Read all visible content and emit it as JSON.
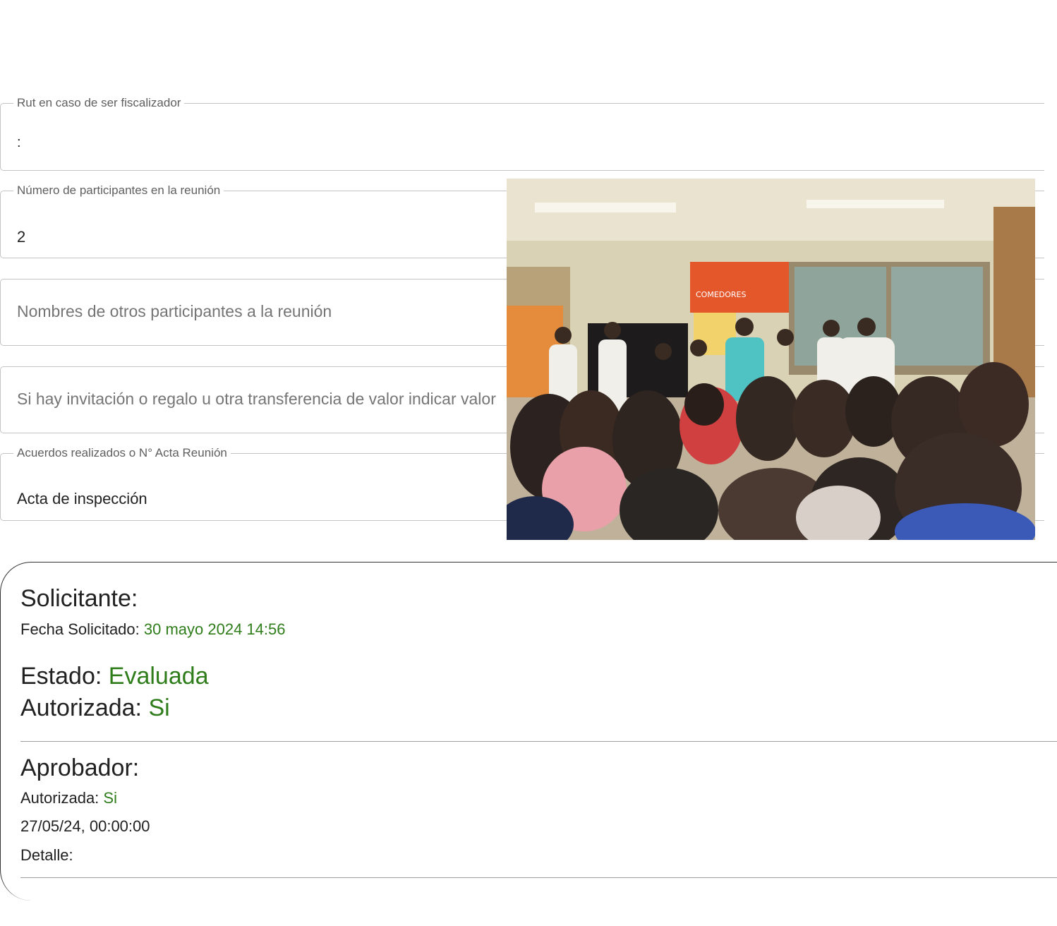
{
  "form": {
    "rut": {
      "label": "Rut en caso de ser fiscalizador",
      "value": ":"
    },
    "participantes": {
      "label": "Número de participantes en la reunión",
      "value": "2"
    },
    "nombres": {
      "placeholder": "Nombres de otros participantes a la reunión"
    },
    "invitacion": {
      "placeholder": "Si hay invitación o regalo u otra transferencia de valor indicar valor"
    },
    "acuerdos": {
      "label": "Acuerdos realizados o N° Acta Reunión",
      "value": "Acta de inspección"
    }
  },
  "photo": {
    "sign_text": "COMEDORES"
  },
  "solicitante": {
    "title": "Solicitante:",
    "fecha_label": "Fecha Solicitado:",
    "fecha_value": "30 mayo 2024 14:56",
    "estado_label": "Estado:",
    "estado_value": "Evaluada",
    "autorizada_label": "Autorizada:",
    "autorizada_value": "Si"
  },
  "aprobador": {
    "title": "Aprobador:",
    "autorizada_label": "Autorizada:",
    "autorizada_value": "Si",
    "fecha_value": "27/05/24, 00:00:00",
    "detalle_label": "Detalle:"
  },
  "colors": {
    "accent_green": "#2e7d1a",
    "border": "#c4c4c4"
  }
}
